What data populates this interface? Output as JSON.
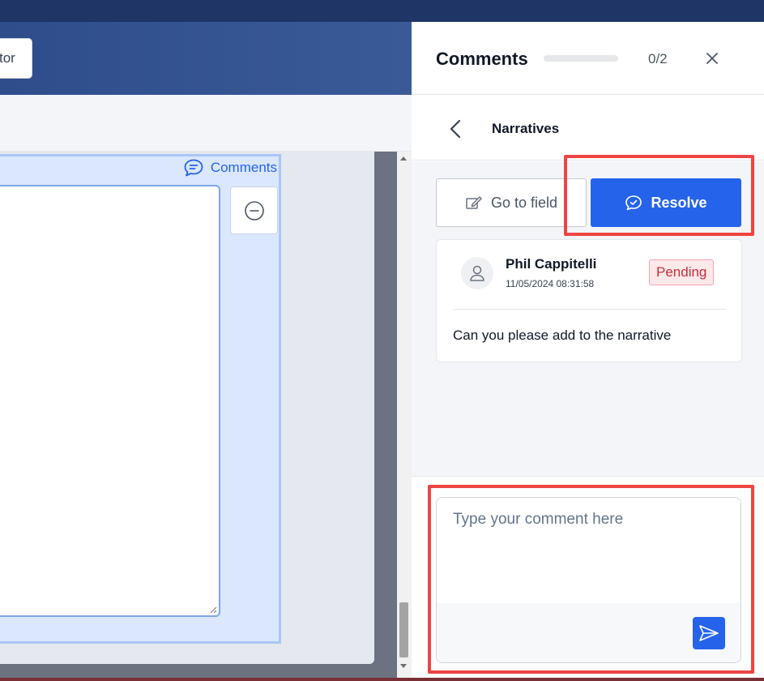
{
  "app": {
    "header_button_label": "tor"
  },
  "field": {
    "comments_link_label": "Comments"
  },
  "panel": {
    "title": "Comments",
    "progress_fraction": 0.0,
    "count_label": "0/2",
    "section_title": "Narratives",
    "goto_field_label": "Go to field",
    "resolve_label": "Resolve",
    "accent_color": "#2563eb",
    "highlight_color": "#ef4444"
  },
  "comment": {
    "author": "Phil Cappitelli",
    "timestamp": "11/05/2024 08:31:58",
    "status": "Pending",
    "text": "Can you please add to the narrative"
  },
  "composer": {
    "placeholder": "Type your comment here",
    "value": ""
  },
  "icons": {
    "comments": "chat-bubble-icon",
    "minus": "minus-circle-icon",
    "close": "close-icon",
    "back": "chevron-left-icon",
    "goto_field": "edit-icon",
    "resolve": "check-bubble-icon",
    "avatar": "user-icon",
    "send": "send-icon"
  }
}
